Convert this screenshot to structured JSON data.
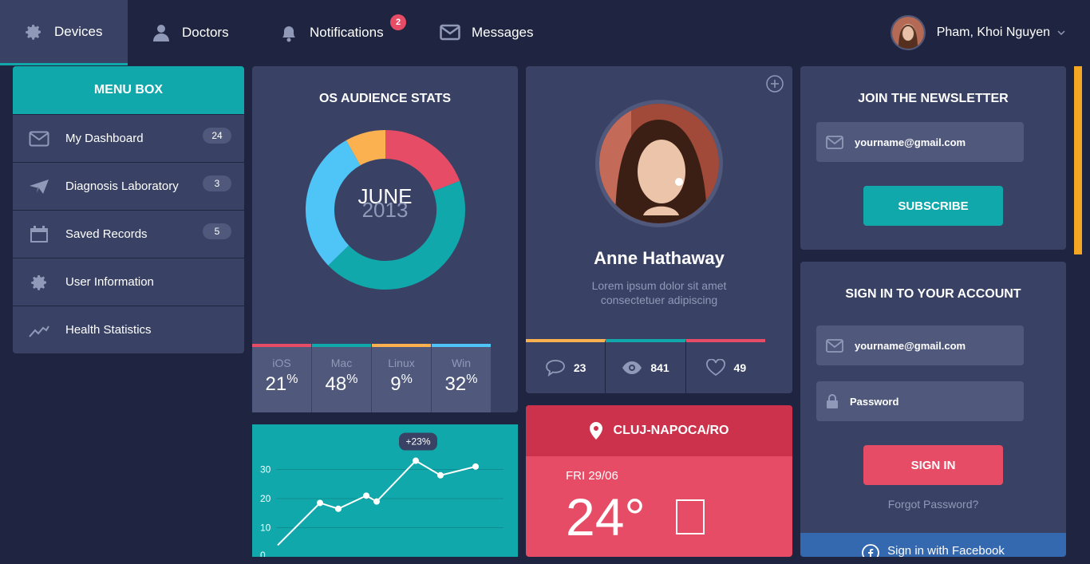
{
  "nav": {
    "items": [
      {
        "label": "Devices",
        "icon": "gear-icon"
      },
      {
        "label": "Doctors",
        "icon": "person-icon"
      },
      {
        "label": "Notifications",
        "icon": "bell-icon",
        "badge": "2"
      },
      {
        "label": "Messages",
        "icon": "envelope-icon"
      }
    ],
    "user_name": "Pham, Khoi Nguyen"
  },
  "menu": {
    "title": "MENU BOX",
    "items": [
      {
        "label": "My Dashboard",
        "icon": "envelope-icon",
        "count": "24"
      },
      {
        "label": "Diagnosis Laboratory",
        "icon": "paper-plane-icon",
        "count": "3"
      },
      {
        "label": "Saved Records",
        "icon": "calendar-icon",
        "count": "5"
      },
      {
        "label": "User Information",
        "icon": "gear-icon"
      },
      {
        "label": "Health Statistics",
        "icon": "trend-icon"
      }
    ]
  },
  "os_stats": {
    "title": "OS AUDIENCE STATS",
    "month": "JUNE",
    "year": "2013",
    "segments": [
      {
        "name": "iOS",
        "value": "21",
        "color": "#e64c65"
      },
      {
        "name": "Mac",
        "value": "48",
        "color": "#11a8ab"
      },
      {
        "name": "Linux",
        "value": "9",
        "color": "#fcb150"
      },
      {
        "name": "Win",
        "value": "32",
        "color": "#4fc4f6"
      }
    ],
    "percent_sign": "%"
  },
  "profile": {
    "name": "Anne Hathaway",
    "desc_line1": "Lorem ipsum dolor sit amet",
    "desc_line2": "consectetuer adipiscing",
    "stats": [
      {
        "icon": "comment-icon",
        "value": "23",
        "color": "#fcb150"
      },
      {
        "icon": "eye-icon",
        "value": "841",
        "color": "#11a8ab"
      },
      {
        "icon": "heart-icon",
        "value": "49",
        "color": "#e64c65"
      }
    ]
  },
  "newsletter": {
    "title": "JOIN THE NEWSLETTER",
    "email": "yourname@gmail.com",
    "button": "SUBSCRIBE"
  },
  "signin": {
    "title": "SIGN IN TO YOUR ACCOUNT",
    "email": "yourname@gmail.com",
    "password": "Password",
    "button": "SIGN IN",
    "forgot": "Forgot Password?",
    "facebook": "Sign in with Facebook"
  },
  "weather": {
    "location": "CLUJ-NAPOCA/RO",
    "date": "FRI 29/06",
    "temp": "24°"
  },
  "chart_data": {
    "type": "line",
    "badge": "+23%",
    "x": [
      0,
      1,
      2,
      3,
      4,
      5,
      6,
      7
    ],
    "values": [
      4,
      18.5,
      16.5,
      21,
      19,
      33,
      28,
      31
    ],
    "yticks": [
      "0",
      "10",
      "20",
      "30"
    ],
    "ylim": [
      0,
      40
    ],
    "grid": true
  }
}
